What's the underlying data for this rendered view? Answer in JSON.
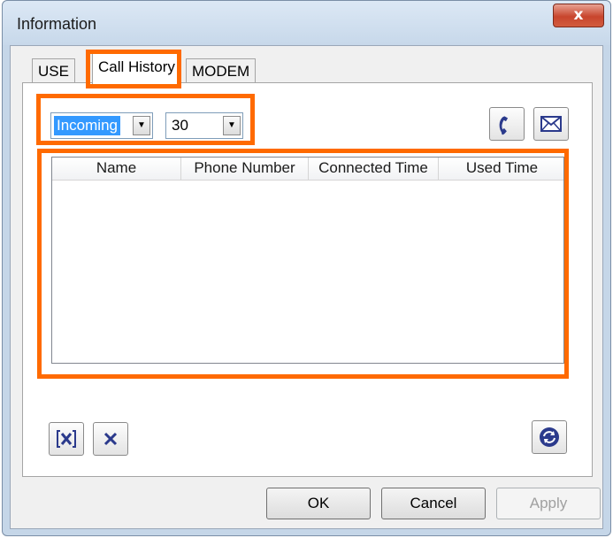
{
  "window": {
    "title": "Information",
    "close_glyph": "x"
  },
  "tabs": [
    {
      "label": "USE"
    },
    {
      "label": "Call History"
    },
    {
      "label": "MODEM"
    }
  ],
  "filters": {
    "call_type": {
      "value": "Incoming"
    },
    "count": {
      "value": "30"
    }
  },
  "toolbar": {
    "call_icon": "phone-icon",
    "message_icon": "envelope-icon"
  },
  "table": {
    "columns": [
      "Name",
      "Phone Number",
      "Connected Time",
      "Used Time"
    ],
    "rows": []
  },
  "actions": {
    "delete_selected_icon": "delete-selected-icon",
    "delete_icon": "delete-icon",
    "refresh_icon": "refresh-icon"
  },
  "buttons": {
    "ok": "OK",
    "cancel": "Cancel",
    "apply": "Apply"
  },
  "colors": {
    "highlight": "#ff6a00",
    "selection": "#3399ff",
    "close_button": "#c8452d"
  }
}
